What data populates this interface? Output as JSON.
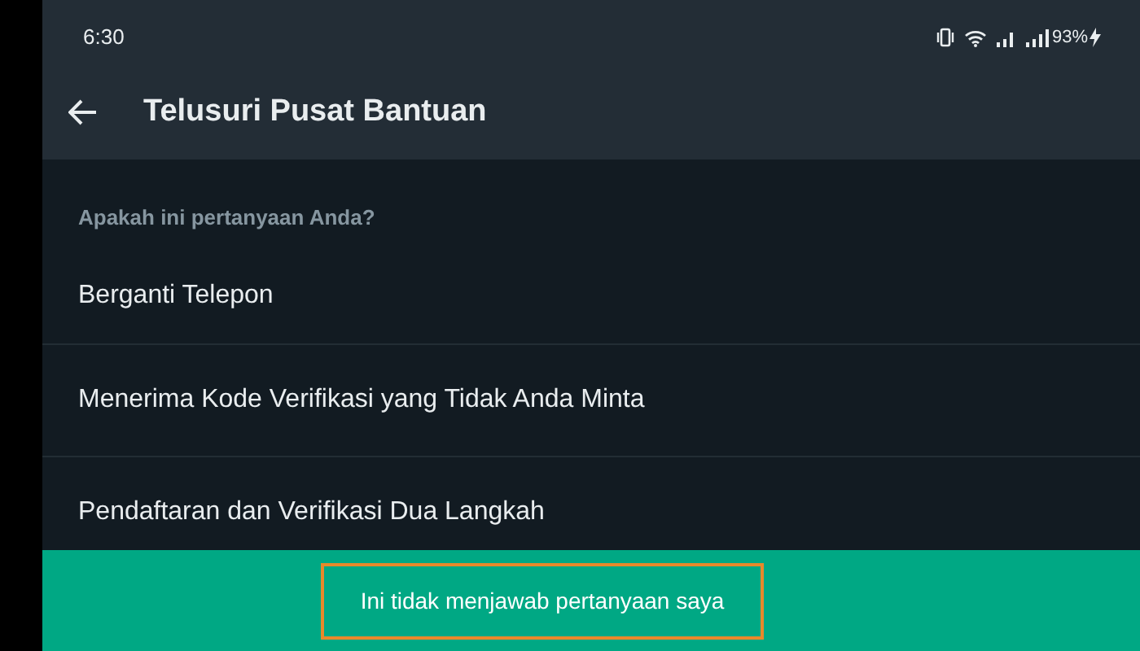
{
  "status_bar": {
    "time": "6:30",
    "battery": "93%"
  },
  "app_bar": {
    "title": "Telusuri Pusat Bantuan"
  },
  "section_header": "Apakah ini pertanyaan Anda?",
  "questions": [
    {
      "label": "Berganti Telepon"
    },
    {
      "label": "Menerima Kode Verifikasi yang Tidak Anda Minta"
    },
    {
      "label": "Pendaftaran dan Verifikasi Dua Langkah"
    }
  ],
  "bottom_button": {
    "label": "Ini tidak menjawab pertanyaan saya",
    "highlighted": true
  }
}
